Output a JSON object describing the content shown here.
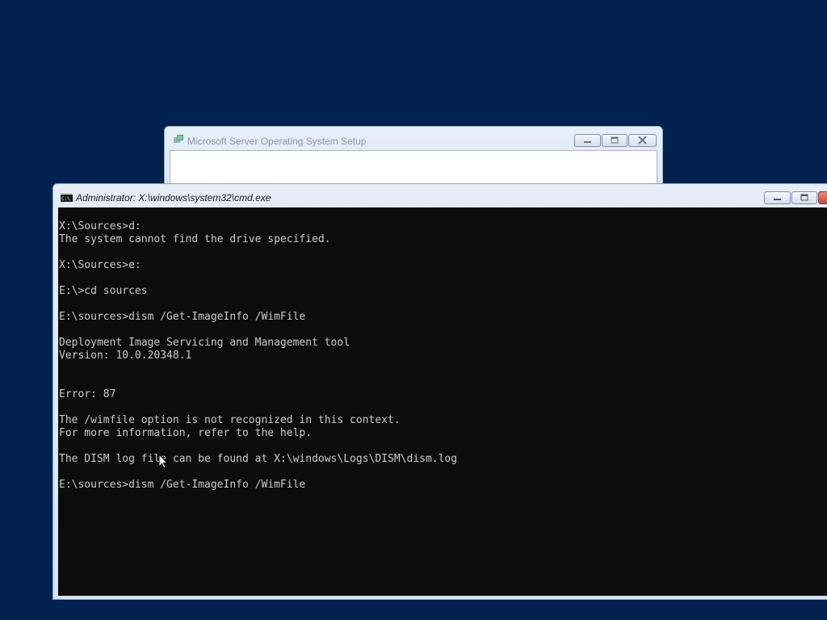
{
  "setup_window": {
    "title": "Microsoft Server Operating System Setup"
  },
  "cmd_window": {
    "title": "Administrator: X:\\windows\\system32\\cmd.exe",
    "lines": [
      "X:\\Sources>d:",
      "The system cannot find the drive specified.",
      "",
      "X:\\Sources>e:",
      "",
      "E:\\>cd sources",
      "",
      "E:\\sources>dism /Get-ImageInfo /WimFile",
      "",
      "Deployment Image Servicing and Management tool",
      "Version: 10.0.20348.1",
      "",
      "",
      "Error: 87",
      "",
      "The /wimfile option is not recognized in this context.",
      "For more information, refer to the help.",
      "",
      "The DISM log file can be found at X:\\windows\\Logs\\DISM\\dism.log",
      "",
      "E:\\sources>dism /Get-ImageInfo /WimFile"
    ]
  },
  "icons": {
    "setup_app": "setup-icon",
    "cmd_app": "cmd-icon",
    "minimize": "minimize-icon",
    "maximize": "maximize-icon",
    "close": "close-icon",
    "pointer": "mouse-pointer-icon"
  },
  "colors": {
    "desktop_background": "#01214f",
    "console_background": "#0c0c0c",
    "console_text": "#cccccc",
    "close_button_red": "#c9463d"
  }
}
